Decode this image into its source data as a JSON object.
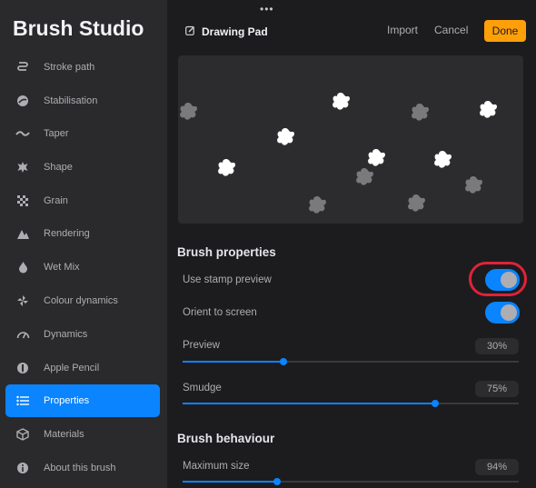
{
  "sidebar": {
    "title": "Brush Studio",
    "items": [
      {
        "label": "Stroke path",
        "icon": "stroke-path-icon"
      },
      {
        "label": "Stabilisation",
        "icon": "stabilisation-icon"
      },
      {
        "label": "Taper",
        "icon": "taper-icon"
      },
      {
        "label": "Shape",
        "icon": "shape-icon"
      },
      {
        "label": "Grain",
        "icon": "grain-icon"
      },
      {
        "label": "Rendering",
        "icon": "rendering-icon"
      },
      {
        "label": "Wet Mix",
        "icon": "wet-mix-icon"
      },
      {
        "label": "Colour dynamics",
        "icon": "colour-dynamics-icon"
      },
      {
        "label": "Dynamics",
        "icon": "dynamics-icon"
      },
      {
        "label": "Apple Pencil",
        "icon": "apple-pencil-icon"
      },
      {
        "label": "Properties",
        "icon": "properties-icon",
        "active": true
      },
      {
        "label": "Materials",
        "icon": "materials-icon"
      },
      {
        "label": "About this brush",
        "icon": "info-icon"
      }
    ]
  },
  "header": {
    "drawing_pad": "Drawing Pad",
    "import": "Import",
    "cancel": "Cancel",
    "done": "Done"
  },
  "colors": {
    "accent": "#0a84ff",
    "done": "#ff9f0a",
    "highlight": "#e0223a"
  },
  "brush_properties": {
    "title": "Brush properties",
    "use_stamp_preview": {
      "label": "Use stamp preview",
      "on": true
    },
    "orient_to_screen": {
      "label": "Orient to screen",
      "on": true
    },
    "preview": {
      "label": "Preview",
      "value": "30%",
      "fraction": 0.3
    },
    "smudge": {
      "label": "Smudge",
      "value": "75%",
      "fraction": 0.75
    }
  },
  "brush_behaviour": {
    "title": "Brush behaviour",
    "maximum_size": {
      "label": "Maximum size",
      "value": "94%",
      "fraction": 0.28
    }
  }
}
